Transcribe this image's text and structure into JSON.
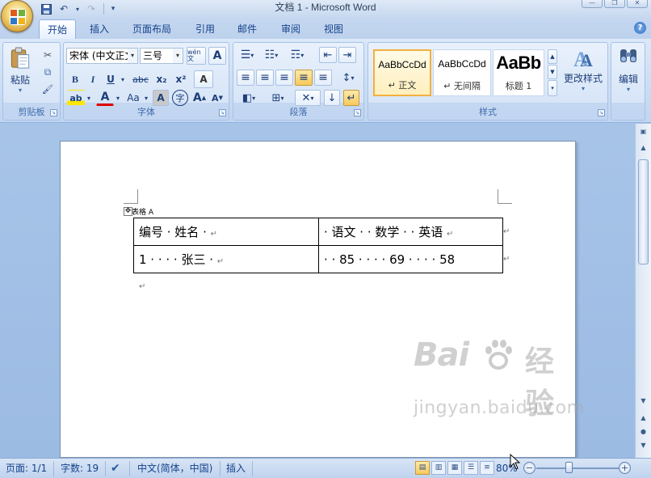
{
  "window": {
    "title": "文档 1 - Microsoft Word",
    "minimize": "—",
    "restore": "❐",
    "close": "✕"
  },
  "qat": {
    "save_icon": "💾",
    "undo_icon": "↶",
    "redo_icon": "↷",
    "customize_icon": "▾"
  },
  "tabs": [
    {
      "label": "开始",
      "active": true
    },
    {
      "label": "插入"
    },
    {
      "label": "页面布局"
    },
    {
      "label": "引用"
    },
    {
      "label": "邮件"
    },
    {
      "label": "审阅"
    },
    {
      "label": "视图"
    }
  ],
  "help": "?",
  "ribbon": {
    "clipboard": {
      "group_label": "剪贴板",
      "paste_label": "粘贴",
      "cut_icon": "✂",
      "copy_icon": "⧉",
      "format_painter_icon": "🖌"
    },
    "font": {
      "group_label": "字体",
      "font_name": "宋体 (中文正文",
      "font_size": "三号",
      "phonetic_guide": "wén 文",
      "char_border": "A",
      "bold": "B",
      "italic": "I",
      "underline": "U",
      "strikethrough": "abc",
      "subscript": "x₂",
      "superscript": "x²",
      "clear_format": "A",
      "highlight": "ab",
      "font_color": "A",
      "change_case": "Aa",
      "char_shading": "A",
      "enclose_char": "字",
      "grow_font": "A",
      "shrink_font": "A"
    },
    "paragraph": {
      "group_label": "段落",
      "bullets": "☰",
      "numbering": "☷",
      "multilevel": "☶",
      "decrease_indent": "⇤",
      "increase_indent": "⇥",
      "align_left": "≡",
      "center": "≡",
      "align_right": "≡",
      "justify": "≡",
      "distribute": "≡",
      "line_spacing": "↕",
      "shading": "◧",
      "borders": "⊞",
      "asian_layout": "✕",
      "sort": "↓",
      "show_marks": "↵"
    },
    "styles": {
      "group_label": "样式",
      "items": [
        {
          "sample": "AaBbCcDd",
          "name": "↵ 正文"
        },
        {
          "sample": "AaBbCcDd",
          "name": "↵ 无间隔"
        },
        {
          "sample": "AaBb",
          "name": "标题 1"
        }
      ],
      "change_styles": "更改样式"
    },
    "editing": {
      "label": "编辑"
    }
  },
  "document": {
    "caption": "表格 A",
    "table": [
      [
        "编号 · 姓名 ·",
        "· 语文 · · 数学 · · 英语"
      ],
      [
        "1 · · · · 张三 ·",
        "· · 85 · · · · 69 · · · · 58"
      ]
    ],
    "cell_mark": "↵",
    "row_mark": "↵",
    "paragraph_mark": "↵"
  },
  "watermark": {
    "bai": "Bai",
    "jingyan": "经验",
    "url": "jingyan.baidu.com"
  },
  "status": {
    "page": "页面: 1/1",
    "words": "字数: 19",
    "proofing_icon": "✔",
    "language": "中文(简体，中国)",
    "mode": "插入",
    "zoom": "80%",
    "zoom_percent": 80,
    "zoom_out": "−",
    "zoom_in": "+"
  }
}
